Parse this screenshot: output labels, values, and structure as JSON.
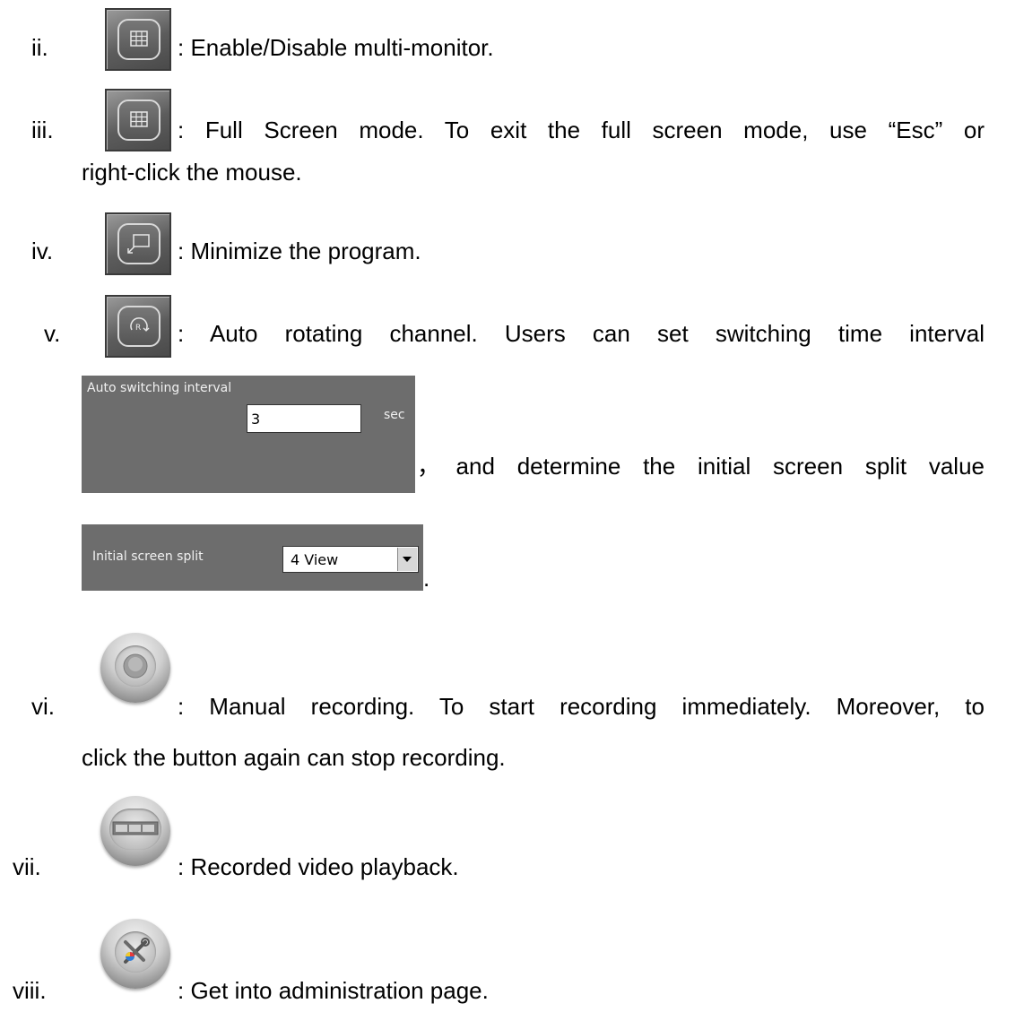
{
  "items": [
    {
      "num": "ii.",
      "icon": "multi-monitor-icon",
      "text": ": Enable/Disable multi-monitor."
    },
    {
      "num": "iii.",
      "icon": "full-screen-icon",
      "text": ": Full Screen mode. To exit the full screen mode, use “Esc” or",
      "cont": "right-click the mouse."
    },
    {
      "num": "iv.",
      "icon": "minimize-icon",
      "text": ": Minimize the program."
    },
    {
      "num": "v.",
      "icon": "auto-rotate-icon",
      "text": ": Auto rotating channel. Users can set switching time interval"
    },
    {
      "num": "vi.",
      "icon": "record-icon",
      "text": ": Manual recording. To start recording immediately. Moreover, to",
      "cont": "click the button again can stop recording."
    },
    {
      "num": "vii.",
      "icon": "playback-icon",
      "text": ": Recorded video playback."
    },
    {
      "num": "viii.",
      "icon": "admin-tools-icon",
      "text": ": Get into administration page."
    }
  ],
  "interval_panel": {
    "label": "Auto switching interval",
    "value": "3",
    "unit": "sec"
  },
  "after_interval_text": "，and determine the initial screen split value",
  "split_panel": {
    "label": "Initial screen split",
    "selected": "4 View"
  },
  "after_split_text": ".",
  "colors": {
    "panel_bg": "#6d6d6d",
    "button_gray": "#5c5c5c"
  }
}
